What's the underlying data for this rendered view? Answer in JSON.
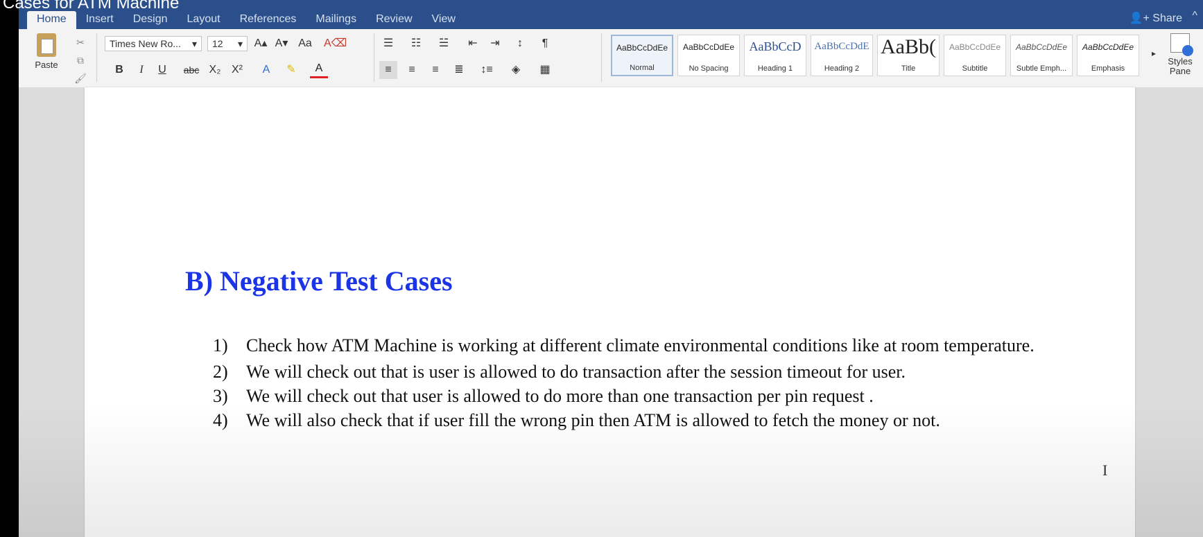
{
  "video_title": "Cases for ATM Machine",
  "tabs": [
    "Home",
    "Insert",
    "Design",
    "Layout",
    "References",
    "Mailings",
    "Review",
    "View"
  ],
  "share_label": "Share",
  "ribbon": {
    "paste_label": "Paste",
    "font_name": "Times New Ro...",
    "font_size": "12",
    "bold": "B",
    "italic": "I",
    "underline": "U",
    "strikethrough": "abc",
    "subscript": "X₂",
    "superscript": "X²",
    "font_color_letter": "A",
    "pilcrow": "¶",
    "styles": [
      {
        "sample": "AaBbCcDdEe",
        "name": "Normal",
        "selected": true
      },
      {
        "sample": "AaBbCcDdEe",
        "name": "No Spacing",
        "selected": false
      },
      {
        "sample": "AaBbCcD",
        "name": "Heading 1",
        "selected": false
      },
      {
        "sample": "AaBbCcDdE",
        "name": "Heading 2",
        "selected": false
      },
      {
        "sample": "AaBb(",
        "name": "Title",
        "selected": false
      },
      {
        "sample": "AaBbCcDdEe",
        "name": "Subtitle",
        "selected": false
      },
      {
        "sample": "AaBbCcDdEe",
        "name": "Subtle Emph...",
        "selected": false
      },
      {
        "sample": "AaBbCcDdEe",
        "name": "Emphasis",
        "selected": false
      }
    ],
    "styles_pane_label_1": "Styles",
    "styles_pane_label_2": "Pane"
  },
  "document": {
    "heading": "B) Negative Test Cases",
    "items": [
      {
        "num": "1)",
        "text": "Check how ATM Machine is working at different climate environmental conditions like at room temperature."
      },
      {
        "num": "2)",
        "text": "We will check out that is user is allowed to do transaction after the session timeout for user."
      },
      {
        "num": "3)",
        "text": "We will check out that user is allowed to do more than one transaction per pin request ."
      },
      {
        "num": "4)",
        "text": "We will also check that if user fill the wrong pin then ATM is allowed to fetch the money or not."
      }
    ]
  },
  "colors": {
    "title_bar": "#2a4f8a",
    "heading_text": "#1b35e6",
    "ribbon_bg": "#f3f3f3"
  },
  "icons": {
    "share": "person-plus-icon",
    "collapse": "chevron-up-icon"
  }
}
